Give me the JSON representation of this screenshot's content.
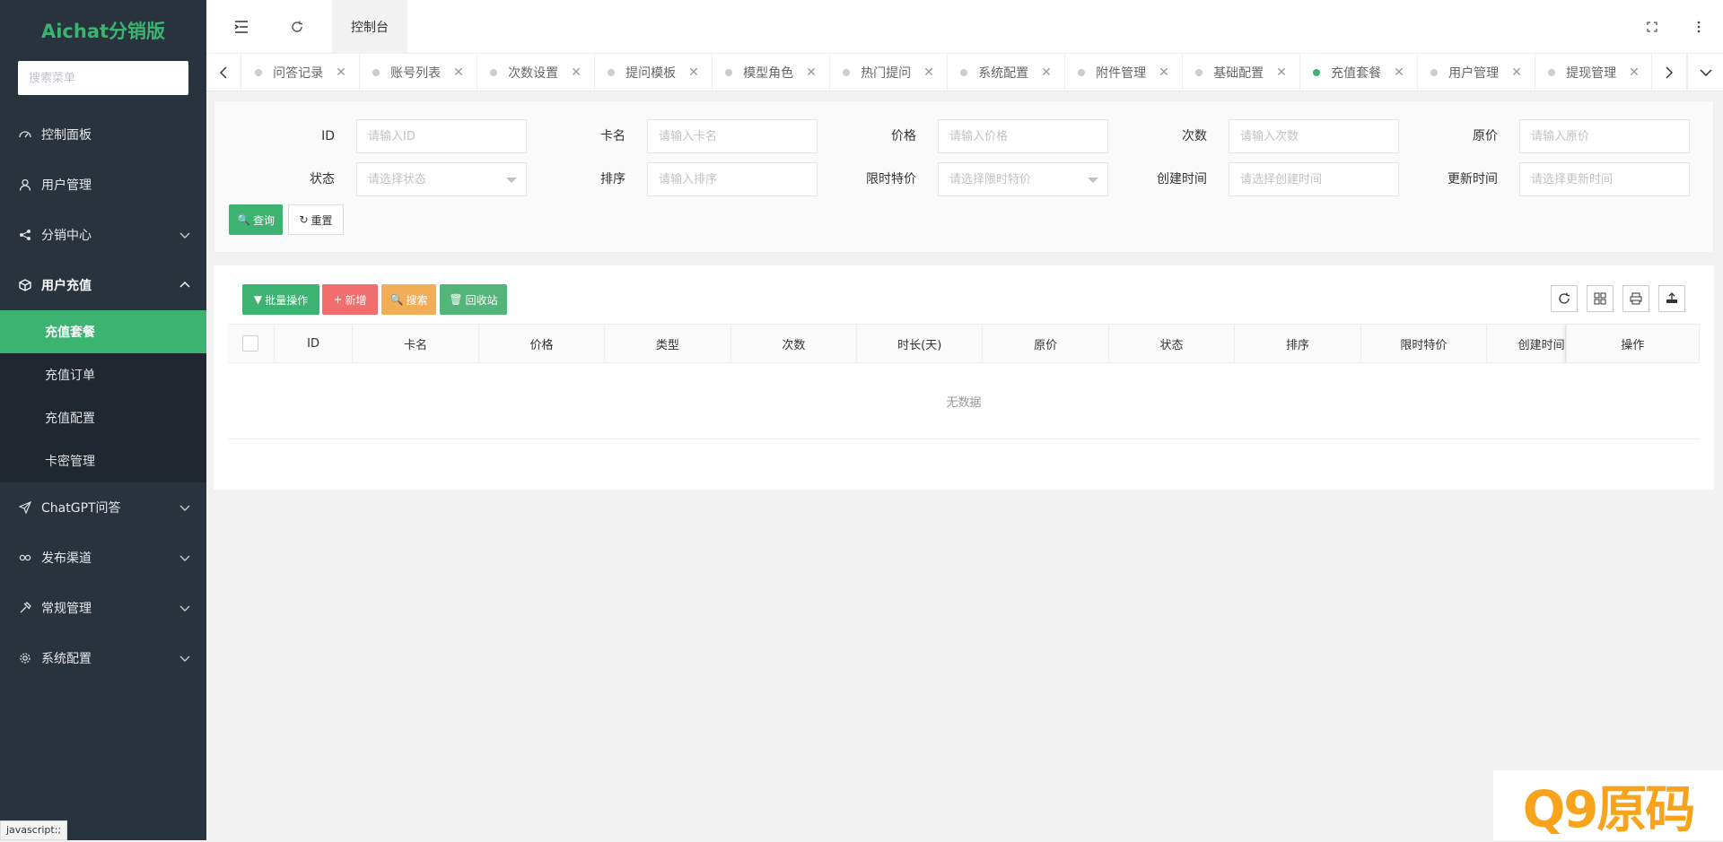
{
  "sidebar": {
    "logo": "Aichat分销版",
    "search_placeholder": "搜索菜单",
    "items": [
      {
        "label": "控制面板",
        "icon": "dashboard-icon",
        "has_arrow": false
      },
      {
        "label": "用户管理",
        "icon": "user-icon",
        "has_arrow": false
      },
      {
        "label": "分销中心",
        "icon": "share-icon",
        "has_arrow": true
      },
      {
        "label": "用户充值",
        "icon": "cube-icon",
        "has_arrow": true,
        "open": true
      },
      {
        "label": "ChatGPT问答",
        "icon": "send-icon",
        "has_arrow": true
      },
      {
        "label": "发布渠道",
        "icon": "link-icon",
        "has_arrow": true
      },
      {
        "label": "常规管理",
        "icon": "tools-icon",
        "has_arrow": true
      },
      {
        "label": "系统配置",
        "icon": "gear-icon",
        "has_arrow": true
      }
    ],
    "submenu": [
      "充值套餐",
      "充值订单",
      "充值配置",
      "卡密管理"
    ],
    "submenu_active": 0
  },
  "status_bar": "javascript:;",
  "header": {
    "current_tab": "控制台"
  },
  "tabs": [
    {
      "label": "问答记录",
      "active": false
    },
    {
      "label": "账号列表",
      "active": false
    },
    {
      "label": "次数设置",
      "active": false
    },
    {
      "label": "提问模板",
      "active": false
    },
    {
      "label": "模型角色",
      "active": false
    },
    {
      "label": "热门提问",
      "active": false
    },
    {
      "label": "系统配置",
      "active": false
    },
    {
      "label": "附件管理",
      "active": false
    },
    {
      "label": "基础配置",
      "active": false
    },
    {
      "label": "充值套餐",
      "active": true
    },
    {
      "label": "用户管理",
      "active": false
    },
    {
      "label": "提现管理",
      "active": false
    }
  ],
  "search_form": {
    "row1": [
      {
        "label": "ID",
        "placeholder": "请输入ID",
        "type": "input"
      },
      {
        "label": "卡名",
        "placeholder": "请输入卡名",
        "type": "input"
      },
      {
        "label": "价格",
        "placeholder": "请输入价格",
        "type": "input"
      },
      {
        "label": "次数",
        "placeholder": "请输入次数",
        "type": "input"
      },
      {
        "label": "原价",
        "placeholder": "请输入原价",
        "type": "input"
      }
    ],
    "row2": [
      {
        "label": "状态",
        "placeholder": "请选择状态",
        "type": "select"
      },
      {
        "label": "排序",
        "placeholder": "请输入排序",
        "type": "input"
      },
      {
        "label": "限时特价",
        "placeholder": "请选择限时特价",
        "type": "select"
      },
      {
        "label": "创建时间",
        "placeholder": "请选择创建时间",
        "type": "input"
      },
      {
        "label": "更新时间",
        "placeholder": "请选择更新时间",
        "type": "input"
      }
    ],
    "query_label": "查询",
    "reset_label": "重置"
  },
  "toolbar": {
    "batch_label": "批量操作",
    "add_label": "新增",
    "search_label": "搜索",
    "recycle_label": "回收站"
  },
  "table": {
    "columns": [
      "ID",
      "卡名",
      "价格",
      "类型",
      "次数",
      "时长(天)",
      "原价",
      "状态",
      "排序",
      "限时特价",
      "创建时间",
      "操作"
    ],
    "empty_text": "无数据"
  },
  "watermark": "Q9原码",
  "colors": {
    "accent": "#3cb371",
    "sidebar_bg": "#28333e",
    "add_button": "#f06e6e",
    "search_button": "#f2ad57"
  }
}
